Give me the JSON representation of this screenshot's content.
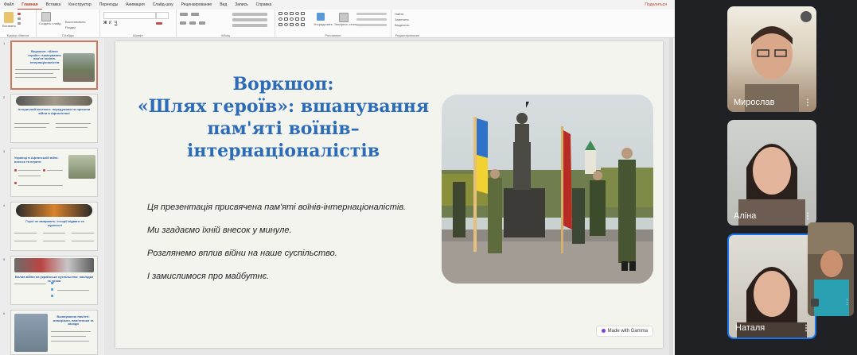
{
  "menu": {
    "tabs": [
      "Файл",
      "Главная",
      "Вставка",
      "Конструктор",
      "Переходы",
      "Анимация",
      "Слайд-шоу",
      "Рецензирование",
      "Вид",
      "Запись",
      "Справка"
    ],
    "active": "Главная",
    "share": "Поделиться"
  },
  "ribbon": {
    "paste": "Вставить",
    "new_slide": "Создать слайд",
    "restore": "Восстановить",
    "sections": "Раздел",
    "arrange": "Упорядочить",
    "quick_styles": "Экспресс-стили",
    "find": "Найти",
    "replace": "Заменить",
    "select": "Выделить",
    "groups": [
      "Буфер обмена",
      "Слайды",
      "Шрифт",
      "Абзац",
      "Рисование",
      "Редактирование"
    ]
  },
  "thumbnails": [
    {
      "num": "1",
      "title": "Воркшоп: «Шлях героїв»: вшанування пам'яті воїнів-інтернаціоналістів"
    },
    {
      "num": "2",
      "title": "Історичний контекст: передумови та причини війни в Афганістані"
    },
    {
      "num": "3",
      "title": "Українці в Афганській війні: внесок та втрати"
    },
    {
      "num": "4",
      "title": "Герої не вмирають: історії відваги та мужності"
    },
    {
      "num": "5",
      "title": "Вплив війни на українське суспільство: наслідки та уроки"
    },
    {
      "num": "6",
      "title": "Вшанування пам'яті: меморіали, пам'ятники та заходи"
    }
  ],
  "slide": {
    "title_lines": [
      "Воркшоп:",
      "«Шлях героїв»: вшанування",
      "пам'яті воїнів–",
      "інтернаціоналістів"
    ],
    "bullets": [
      "Ця презентація присвячена пам'яті воїнів-інтернаціоналістів.",
      "Ми згадаємо їхній внесок у минуле.",
      "Розглянемо вплив війни на наше суспільство.",
      "І замислимося про майбутнє."
    ],
    "badge": "Made with Gamma"
  },
  "participants": [
    {
      "name": "Мирослав",
      "muted": true
    },
    {
      "name": "Аліна",
      "muted": false
    },
    {
      "name": "Наталя",
      "muted": false
    }
  ]
}
